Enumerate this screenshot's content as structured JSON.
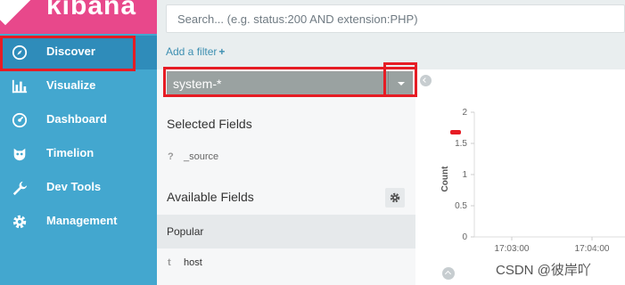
{
  "brand": {
    "name": "kibana"
  },
  "sidebar": {
    "items": [
      {
        "label": "Discover",
        "icon": "compass-icon"
      },
      {
        "label": "Visualize",
        "icon": "bar-chart-icon"
      },
      {
        "label": "Dashboard",
        "icon": "gauge-icon"
      },
      {
        "label": "Timelion",
        "icon": "timelion-icon"
      },
      {
        "label": "Dev Tools",
        "icon": "wrench-icon"
      },
      {
        "label": "Management",
        "icon": "gear-icon"
      }
    ]
  },
  "search": {
    "placeholder": "Search... (e.g. status:200 AND extension:PHP)"
  },
  "filter": {
    "add_label": "Add a filter",
    "plus": "+"
  },
  "index_pattern": {
    "selected": "system-*"
  },
  "fields": {
    "selected_title": "Selected Fields",
    "selected": [
      {
        "type": "?",
        "name": "_source"
      }
    ],
    "available_title": "Available Fields",
    "popular_label": "Popular",
    "available": [
      {
        "type": "t",
        "name": "host"
      }
    ]
  },
  "chart_data": {
    "type": "bar",
    "ylabel": "Count",
    "ylim": [
      0,
      2
    ],
    "yticks": [
      "0",
      "0.5",
      "1",
      "1.5",
      "2"
    ],
    "xticks": [
      "17:03:00",
      "17:04:00"
    ]
  },
  "watermark": "CSDN @彼岸吖",
  "colors": {
    "sidebar": "#43a7cf",
    "sidebar_active": "#2f8cba",
    "brand": "#e8488b",
    "index_box": "#9aa2a1",
    "annotation": "#e61c24"
  }
}
